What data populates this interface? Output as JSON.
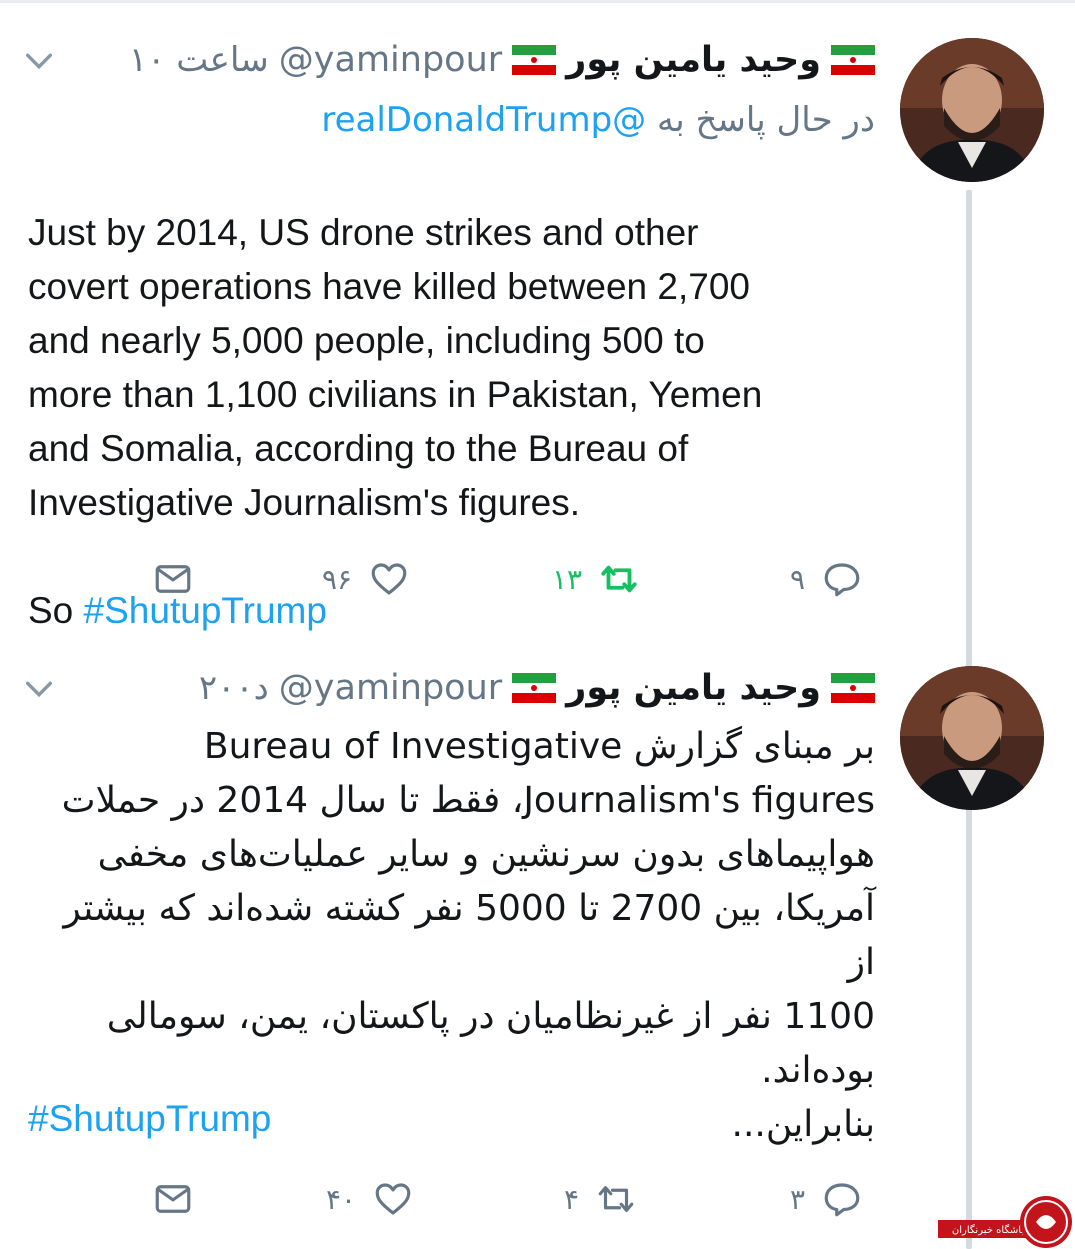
{
  "tweets": [
    {
      "display_name": "وحید یامین پور",
      "handle": "@yaminpour",
      "time": "۱۰ ساعت",
      "reply_label": "در حال پاسخ به",
      "reply_mention": "@realDonaldTrump",
      "text_lines": "Just by 2014, US drone strikes and other\ncovert operations have killed between 2,700\nand nearly 5,000 people, including 500 to\nmore than 1,100 civilians in Pakistan, Yemen\nand Somalia, according to the Bureau of\nInvestigative Journalism's figures.",
      "text_so": "So ",
      "hashtag": "#ShutupTrump",
      "replies": "۹",
      "retweets": "۱۳",
      "likes": "۹۶"
    },
    {
      "display_name": "وحید یامین پور",
      "handle": "@yaminpour",
      "time": "۲۰۰د",
      "text_fa": "بر مبنای گزارش Bureau of Investigative\nJournalism's figures، فقط تا سال 2014 در حملات\nهواپیماهای بدون سرنشین و سایر عملیات‌های مخفی\nآمریکا، بین 2700 تا 5000 نفر کشته شده‌اند که بیشتر از\n1100 نفر از غیرنظامیان در پاکستان، یمن، سومالی\nبوده‌اند.\nبنابراین...",
      "hashtag": "#ShutupTrump",
      "replies": "۳",
      "retweets": "۴",
      "likes": "۴۰"
    }
  ],
  "watermark_text": "باشگاه خبرنگاران",
  "colors": {
    "link": "#1da1f2",
    "muted": "#657786",
    "retweet_active": "#17bf63",
    "flag_green": "#239f40",
    "flag_red": "#da0000"
  }
}
